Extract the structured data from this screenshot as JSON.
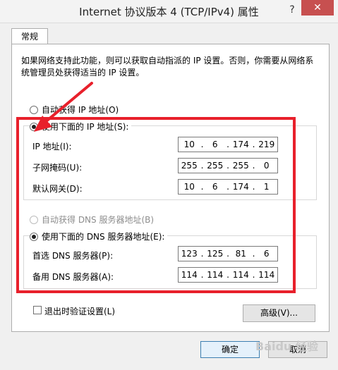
{
  "window": {
    "title": "Internet 协议版本 4 (TCP/IPv4) 属性",
    "help": "?",
    "close": "✕"
  },
  "tabs": [
    {
      "label": "常规"
    }
  ],
  "description": "如果网络支持此功能，则可以获取自动指派的 IP 设置。否则，你需要从网络系统管理员处获得适当的 IP 设置。",
  "ip_section": {
    "auto_label": "自动获得 IP 地址(O)",
    "manual_label": "使用下面的 IP 地址(S):",
    "selected": "manual",
    "fields": [
      {
        "label": "IP 地址(I):",
        "octets": [
          "10",
          "6",
          "174",
          "219"
        ]
      },
      {
        "label": "子网掩码(U):",
        "octets": [
          "255",
          "255",
          "255",
          "0"
        ]
      },
      {
        "label": "默认网关(D):",
        "octets": [
          "10",
          "6",
          "174",
          "1"
        ]
      }
    ]
  },
  "dns_section": {
    "auto_label": "自动获得 DNS 服务器地址(B)",
    "manual_label": "使用下面的 DNS 服务器地址(E):",
    "selected": "manual",
    "fields": [
      {
        "label": "首选 DNS 服务器(P):",
        "octets": [
          "123",
          "125",
          "81",
          "6"
        ]
      },
      {
        "label": "备用 DNS 服务器(A):",
        "octets": [
          "114",
          "114",
          "114",
          "114"
        ]
      }
    ]
  },
  "validate_label": "退出时验证设置(L)",
  "advanced_label": "高级(V)...",
  "ok_label": "确定",
  "cancel_label": "取消",
  "watermark": "Baidu 经验",
  "colors": {
    "annotation": "#e8202b",
    "close_button": "#c75050"
  }
}
